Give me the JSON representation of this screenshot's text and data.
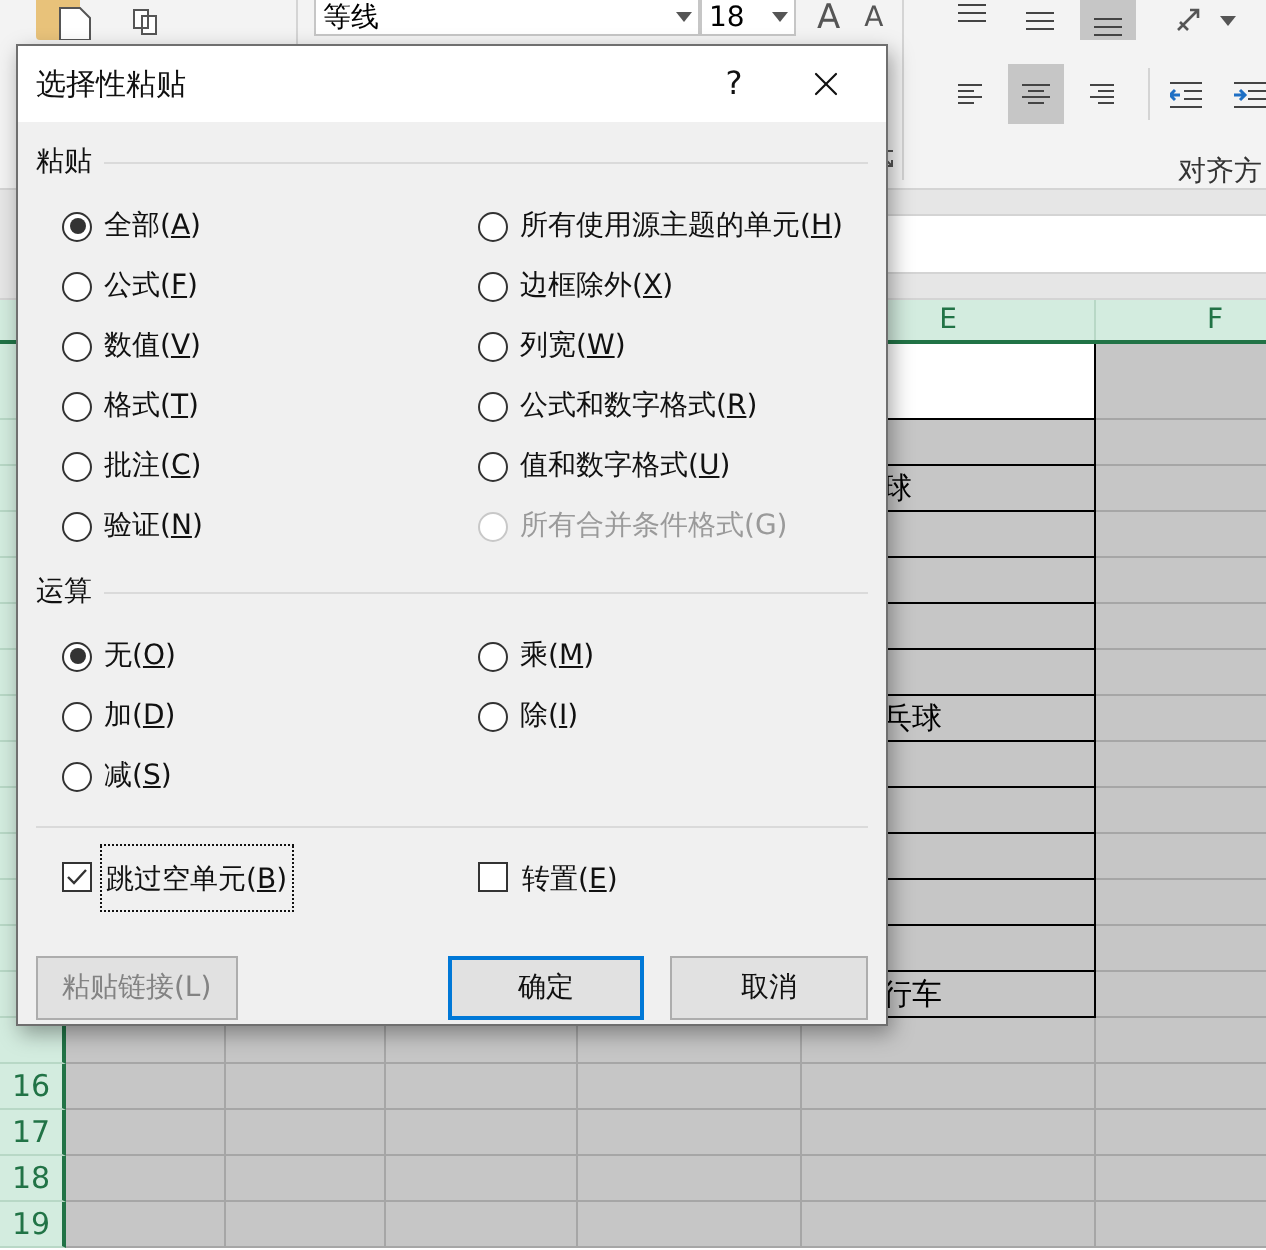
{
  "ribbon": {
    "font_name": "等线",
    "font_size": "18",
    "grow_font": "A",
    "shrink_font": "A",
    "group_label": "对齐方",
    "vertical_align_buttons": [
      {
        "selected": false
      },
      {
        "selected": false
      },
      {
        "selected": true
      }
    ],
    "horizontal_align_buttons": [
      {
        "selected": false
      },
      {
        "selected": true
      },
      {
        "selected": false
      }
    ]
  },
  "sheet": {
    "column_headers": [
      "E",
      "F"
    ],
    "e_column": [
      {
        "kind": "white"
      },
      {
        "kind": "grey"
      },
      {
        "kind": "grey",
        "text": "球"
      },
      {
        "kind": "grey"
      },
      {
        "kind": "grey"
      },
      {
        "kind": "grey"
      },
      {
        "kind": "grey"
      },
      {
        "kind": "grey",
        "text": "乓球"
      },
      {
        "kind": "grey"
      },
      {
        "kind": "grey"
      },
      {
        "kind": "grey"
      },
      {
        "kind": "grey"
      },
      {
        "kind": "grey"
      },
      {
        "kind": "grey",
        "text": "行车"
      }
    ],
    "lower_rows": [
      {
        "number": "16"
      },
      {
        "number": "17"
      },
      {
        "number": "18"
      },
      {
        "number": "19"
      }
    ]
  },
  "dialog": {
    "title": "选择性粘贴",
    "help": "?",
    "sections": [
      {
        "title": "粘贴",
        "options": [
          {
            "label": "全部(",
            "mnemonic": "A",
            "suffix": ")",
            "selected": true,
            "disabled": false
          },
          {
            "label": "所有使用源主题的单元(",
            "mnemonic": "H",
            "suffix": ")",
            "selected": false,
            "disabled": false
          },
          {
            "label": "公式(",
            "mnemonic": "F",
            "suffix": ")",
            "selected": false,
            "disabled": false
          },
          {
            "label": "边框除外(",
            "mnemonic": "X",
            "suffix": ")",
            "selected": false,
            "disabled": false
          },
          {
            "label": "数值(",
            "mnemonic": "V",
            "suffix": ")",
            "selected": false,
            "disabled": false
          },
          {
            "label": "列宽(",
            "mnemonic": "W",
            "suffix": ")",
            "selected": false,
            "disabled": false
          },
          {
            "label": "格式(",
            "mnemonic": "T",
            "suffix": ")",
            "selected": false,
            "disabled": false
          },
          {
            "label": "公式和数字格式(",
            "mnemonic": "R",
            "suffix": ")",
            "selected": false,
            "disabled": false
          },
          {
            "label": "批注(",
            "mnemonic": "C",
            "suffix": ")",
            "selected": false,
            "disabled": false
          },
          {
            "label": "值和数字格式(",
            "mnemonic": "U",
            "suffix": ")",
            "selected": false,
            "disabled": false
          },
          {
            "label": "验证(",
            "mnemonic": "N",
            "suffix": ")",
            "selected": false,
            "disabled": false
          },
          {
            "label": "所有合并条件格式(G)",
            "selected": false,
            "disabled": true
          }
        ]
      },
      {
        "title": "运算",
        "options": [
          {
            "label": "无(",
            "mnemonic": "O",
            "suffix": ")",
            "selected": true,
            "disabled": false
          },
          {
            "label": "乘(",
            "mnemonic": "M",
            "suffix": ")",
            "selected": false,
            "disabled": false
          },
          {
            "label": "加(",
            "mnemonic": "D",
            "suffix": ")",
            "selected": false,
            "disabled": false
          },
          {
            "label": "除(",
            "mnemonic": "I",
            "suffix": ")",
            "selected": false,
            "disabled": false
          },
          {
            "label": "减(",
            "mnemonic": "S",
            "suffix": ")",
            "selected": false,
            "disabled": false
          }
        ]
      }
    ],
    "checkboxes": [
      {
        "label": "跳过空单元(",
        "mnemonic": "B",
        "suffix": ")",
        "checked": true,
        "focused": true
      },
      {
        "label": "转置(",
        "mnemonic": "E",
        "suffix": ")",
        "checked": false,
        "focused": false
      }
    ],
    "buttons": [
      {
        "label": "粘贴链接(L)",
        "kind": "normal",
        "disabled": true
      },
      {
        "label": "确定",
        "kind": "default",
        "disabled": false
      },
      {
        "label": "取消",
        "kind": "normal",
        "disabled": false
      }
    ]
  }
}
